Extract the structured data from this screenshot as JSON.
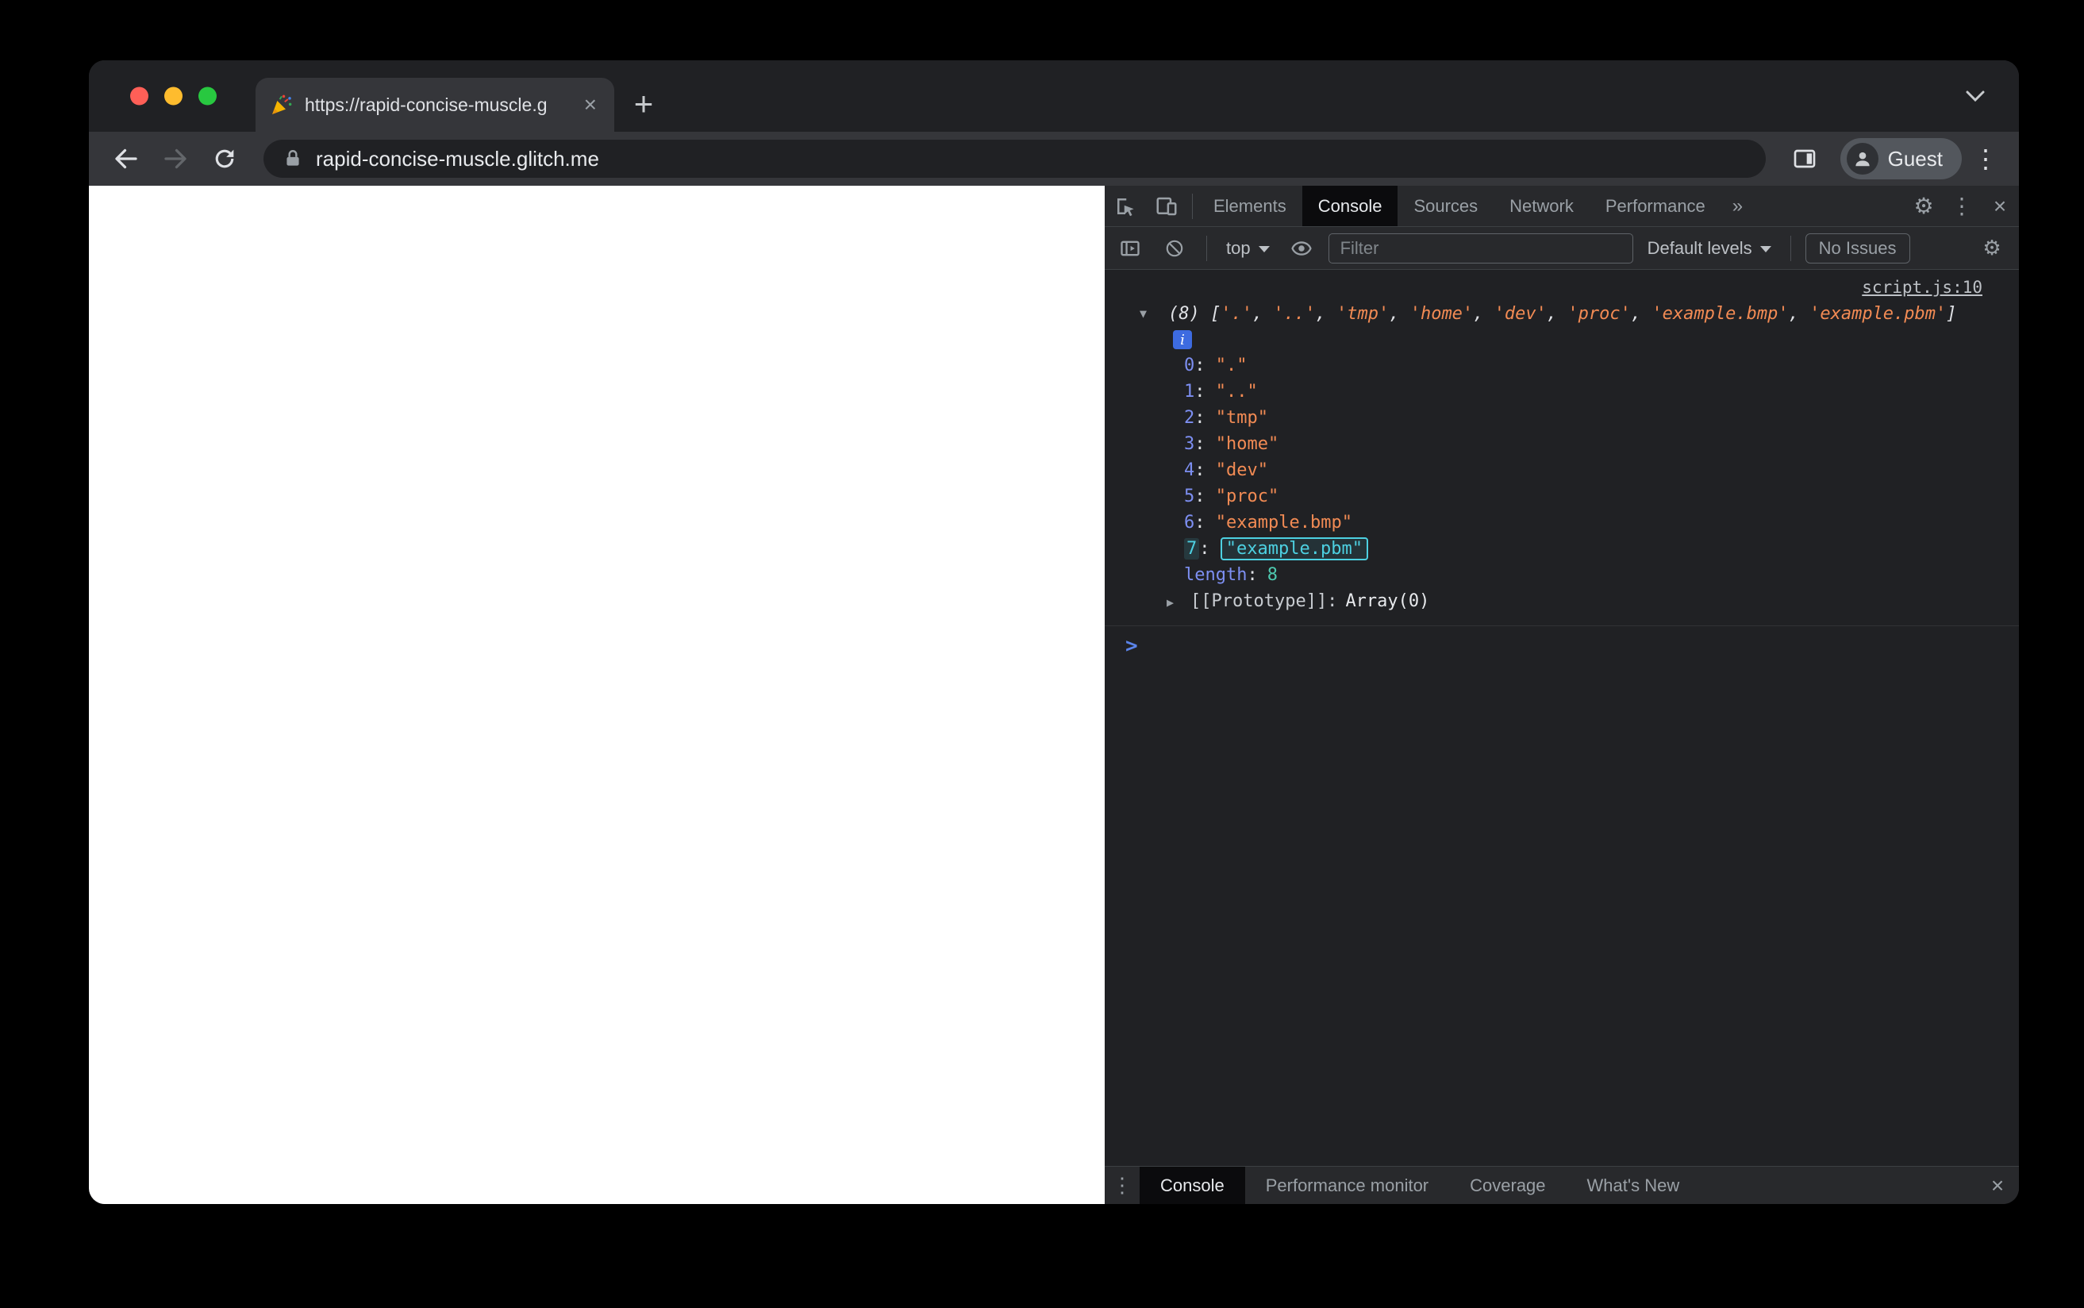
{
  "browser": {
    "tab_title": "https://rapid-concise-muscle.g",
    "url": "rapid-concise-muscle.glitch.me",
    "profile_label": "Guest"
  },
  "devtools": {
    "tabs": [
      "Elements",
      "Console",
      "Sources",
      "Network",
      "Performance"
    ],
    "more_tabs_glyph": "»",
    "toolbar": {
      "context": "top",
      "filter_placeholder": "Filter",
      "levels": "Default levels",
      "issues": "No Issues"
    },
    "console": {
      "source_link": "script.js:10",
      "array_count": "(8)",
      "array_items": [
        ".",
        "..",
        "tmp",
        "home",
        "dev",
        "proc",
        "example.bmp",
        "example.pbm"
      ],
      "entries": [
        {
          "index": "0",
          "value": "."
        },
        {
          "index": "1",
          "value": ".."
        },
        {
          "index": "2",
          "value": "tmp"
        },
        {
          "index": "3",
          "value": "home"
        },
        {
          "index": "4",
          "value": "dev"
        },
        {
          "index": "5",
          "value": "proc"
        },
        {
          "index": "6",
          "value": "example.bmp"
        },
        {
          "index": "7",
          "value": "example.pbm",
          "highlighted": true
        }
      ],
      "length_label": "length",
      "length_value": "8",
      "prototype_label": "[[Prototype]]:",
      "prototype_value": "Array(0)"
    },
    "drawer_tabs": [
      "Console",
      "Performance monitor",
      "Coverage",
      "What's New"
    ]
  },
  "icons": {
    "gear": "⚙",
    "kebab": "⋮",
    "close": "×",
    "plus": "+",
    "expanded": "▼",
    "collapsed": "▶",
    "info": "i",
    "prompt": ">"
  },
  "punct": {
    "colon": ":"
  },
  "colors": {
    "string_token": "#f28b54",
    "index_token": "#7d8ff2",
    "number_token": "#4ec9b0",
    "highlight": "#4dd0e1",
    "devtools_bg": "#202124",
    "chrome_toolbar": "#35363a"
  }
}
